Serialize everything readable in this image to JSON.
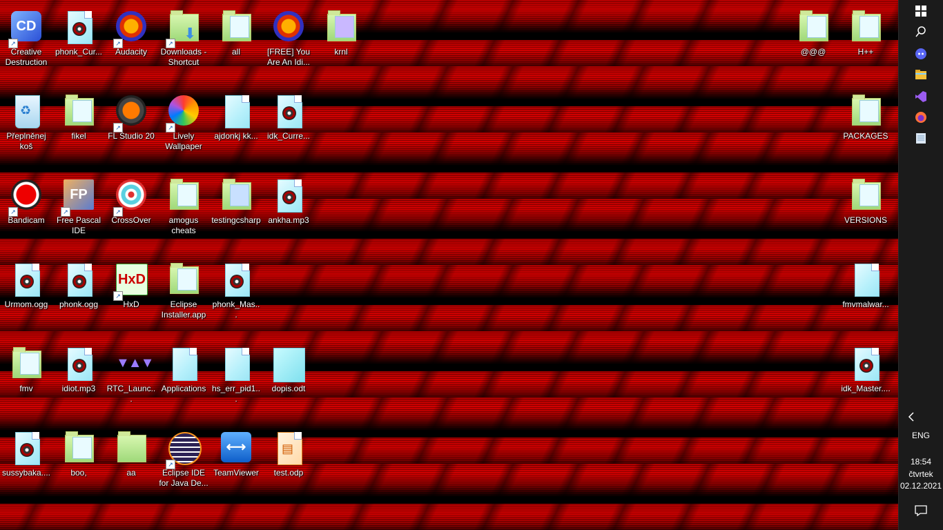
{
  "desktop": {
    "icons": [
      {
        "label": "Creative Destruction",
        "icon": "game-icon"
      },
      {
        "label": "phonk_Cur...",
        "icon": "audio-file-icon"
      },
      {
        "label": "Audacity",
        "icon": "audacity-icon"
      },
      {
        "label": "Downloads - Shortcut",
        "icon": "downloads-folder-icon"
      },
      {
        "label": "all",
        "icon": "folder-icon"
      },
      {
        "label": "[FREE] You Are An Idi...",
        "icon": "audacity-icon"
      },
      {
        "label": "krnl",
        "icon": "folder-icon"
      },
      {
        "label": "@@@",
        "icon": "folder-icon"
      },
      {
        "label": "H++",
        "icon": "folder-icon"
      },
      {
        "label": "Přeplněnej koš",
        "icon": "recycle-bin-icon"
      },
      {
        "label": "fikel",
        "icon": "folder-icon"
      },
      {
        "label": "FL Studio 20",
        "icon": "fl-studio-icon"
      },
      {
        "label": "Lively Wallpaper",
        "icon": "lively-wallpaper-icon"
      },
      {
        "label": "ajdonkj kk...",
        "icon": "file-icon"
      },
      {
        "label": "idk_Curre...",
        "icon": "audio-file-icon"
      },
      {
        "label": "PACKAGES",
        "icon": "folder-icon"
      },
      {
        "label": "Bandicam",
        "icon": "bandicam-icon"
      },
      {
        "label": "Free Pascal IDE",
        "icon": "free-pascal-icon"
      },
      {
        "label": "CrossOver",
        "icon": "crossover-icon"
      },
      {
        "label": "amogus cheats",
        "icon": "folder-icon"
      },
      {
        "label": "testingcsharp",
        "icon": "folder-icon"
      },
      {
        "label": "ankha.mp3",
        "icon": "audio-file-icon"
      },
      {
        "label": "VERSIONS",
        "icon": "folder-icon"
      },
      {
        "label": "Urmom.ogg",
        "icon": "audio-file-icon"
      },
      {
        "label": "phonk.ogg",
        "icon": "audio-file-icon"
      },
      {
        "label": "HxD",
        "icon": "hxd-icon"
      },
      {
        "label": "Eclipse Installer.app",
        "icon": "folder-icon"
      },
      {
        "label": "phonk_Mas...",
        "icon": "audio-file-icon"
      },
      {
        "label": "fmvmalwar...",
        "icon": "file-icon"
      },
      {
        "label": "fmv",
        "icon": "folder-icon"
      },
      {
        "label": "idiot.mp3",
        "icon": "audio-file-icon"
      },
      {
        "label": "RTC_Launc...",
        "icon": "rtc-launcher-icon"
      },
      {
        "label": "Applications",
        "icon": "file-icon"
      },
      {
        "label": "hs_err_pid1...",
        "icon": "file-icon"
      },
      {
        "label": "dopis.odt",
        "icon": "document-icon"
      },
      {
        "label": "idk_Master....",
        "icon": "audio-file-icon"
      },
      {
        "label": "sussybaka....",
        "icon": "audio-file-icon"
      },
      {
        "label": "boo,",
        "icon": "folder-icon"
      },
      {
        "label": "aa",
        "icon": "folder-icon"
      },
      {
        "label": "Eclipse IDE for Java De...",
        "icon": "eclipse-icon"
      },
      {
        "label": "TeamViewer",
        "icon": "teamviewer-icon"
      },
      {
        "label": "test.odp",
        "icon": "presentation-icon"
      }
    ]
  },
  "taskbar": {
    "buttons": [
      {
        "name": "start-button",
        "icon": "windows-logo-icon"
      },
      {
        "name": "search-button",
        "icon": "search-icon"
      },
      {
        "name": "discord-button",
        "icon": "discord-icon"
      },
      {
        "name": "file-explorer-button",
        "icon": "folder-icon"
      },
      {
        "name": "visual-studio-button",
        "icon": "visual-studio-icon"
      },
      {
        "name": "firefox-button",
        "icon": "firefox-icon"
      },
      {
        "name": "notepad-button",
        "icon": "notepad-icon"
      }
    ],
    "language": "ENG",
    "time": "18:54",
    "day": "čtvrtek",
    "date": "02.12.2021"
  },
  "colors": {
    "wallpaper_red": "#d40000",
    "taskbar_bg": "#1b1b1b",
    "label_text": "#ffffff"
  }
}
